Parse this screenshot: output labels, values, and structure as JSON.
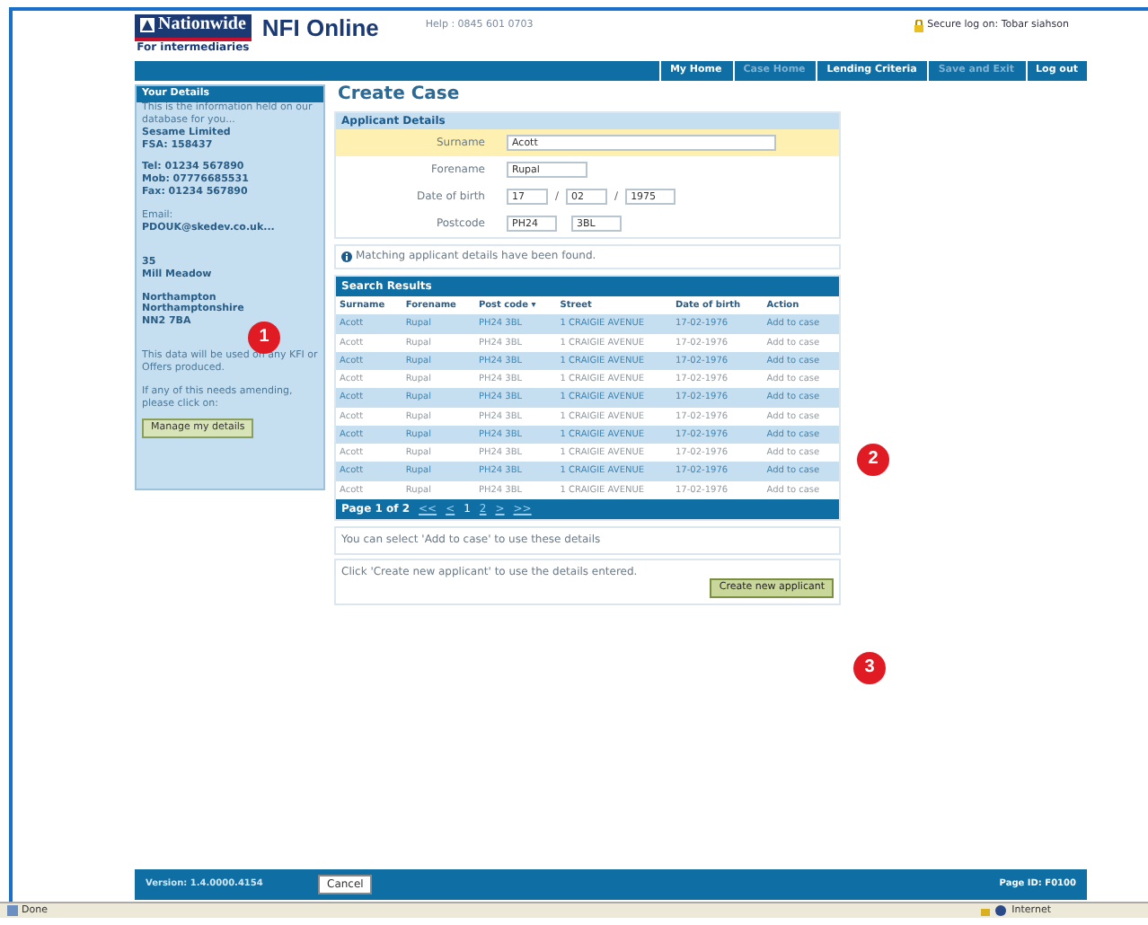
{
  "header": {
    "logo": "Nationwide",
    "logo_sub": "For intermediaries",
    "product": "NFI Online",
    "help": "Help : 0845 601 0703",
    "secure": "Secure log on: Tobar siahson"
  },
  "nav": [
    {
      "label": "My Home",
      "disabled": false
    },
    {
      "label": "Case Home",
      "disabled": true
    },
    {
      "label": "Lending Criteria",
      "disabled": false
    },
    {
      "label": "Save and Exit",
      "disabled": true
    },
    {
      "label": "Log out",
      "disabled": false
    }
  ],
  "sidebar": {
    "title": "Your Details",
    "lines": [
      {
        "kind": "text",
        "text": "This is the information held on our database for you..."
      },
      {
        "kind": "bold",
        "text": "Sesame Limited"
      },
      {
        "kind": "bold",
        "text": "FSA: 158437"
      },
      {
        "kind": "gap"
      },
      {
        "kind": "bold",
        "text": "Tel: 01234 567890"
      },
      {
        "kind": "bold",
        "text": "Mob: 07776685531"
      },
      {
        "kind": "bold",
        "text": "Fax: 01234 567890"
      },
      {
        "kind": "gap"
      },
      {
        "kind": "text",
        "text": "Email:"
      },
      {
        "kind": "bold",
        "text": "PDOUK@skedev.co.uk..."
      },
      {
        "kind": "gap"
      },
      {
        "kind": "gap"
      },
      {
        "kind": "bold",
        "text": "35"
      },
      {
        "kind": "bold",
        "text": "Mill Meadow"
      },
      {
        "kind": "gap"
      },
      {
        "kind": "bold",
        "text": "Northampton"
      },
      {
        "kind": "bold",
        "text": "Northamptonshire"
      },
      {
        "kind": "bold",
        "text": "NN2 7BA"
      },
      {
        "kind": "gap"
      },
      {
        "kind": "gap"
      },
      {
        "kind": "text",
        "text": "This data will be used on any KFI or Offers produced."
      },
      {
        "kind": "gap"
      },
      {
        "kind": "text",
        "text": "If any of this needs amending, please click on:"
      }
    ],
    "button": "Manage my details"
  },
  "page_title": "Create Case",
  "applicant": {
    "title": "Applicant Details",
    "fields": [
      {
        "label": "Surname",
        "values": [
          "Acott"
        ],
        "highlighted": true
      },
      {
        "label": "Forename",
        "values": [
          "Rupal"
        ],
        "highlighted": false
      },
      {
        "label": "Date of birth",
        "values": [
          "17",
          "02",
          "1975"
        ],
        "separator": "/",
        "highlighted": false
      },
      {
        "label": "Postcode",
        "values": [
          "PH24",
          "3BL"
        ],
        "highlighted": false
      }
    ]
  },
  "notice": "Matching applicant details have been found.",
  "results": {
    "title": "Search Results",
    "columns": [
      "Surname",
      "Forename",
      "Post code ▾",
      "Street",
      "Date of birth",
      "Action"
    ],
    "rows": [
      [
        "Acott",
        "Rupal",
        "PH24 3BL",
        "1 CRAIGIE AVENUE",
        "17-02-1976",
        "Add to case"
      ],
      [
        "Acott",
        "Rupal",
        "PH24 3BL",
        "1 CRAIGIE AVENUE",
        "17-02-1976",
        "Add to case"
      ],
      [
        "Acott",
        "Rupal",
        "PH24 3BL",
        "1 CRAIGIE AVENUE",
        "17-02-1976",
        "Add to case"
      ],
      [
        "Acott",
        "Rupal",
        "PH24 3BL",
        "1 CRAIGIE AVENUE",
        "17-02-1976",
        "Add to case"
      ],
      [
        "Acott",
        "Rupal",
        "PH24 3BL",
        "1 CRAIGIE AVENUE",
        "17-02-1976",
        "Add to case"
      ],
      [
        "Acott",
        "Rupal",
        "PH24 3BL",
        "1 CRAIGIE AVENUE",
        "17-02-1976",
        "Add to case"
      ],
      [
        "Acott",
        "Rupal",
        "PH24 3BL",
        "1 CRAIGIE AVENUE",
        "17-02-1976",
        "Add to case"
      ],
      [
        "Acott",
        "Rupal",
        "PH24 3BL",
        "1 CRAIGIE AVENUE",
        "17-02-1976",
        "Add to case"
      ],
      [
        "Acott",
        "Rupal",
        "PH24 3BL",
        "1 CRAIGIE AVENUE",
        "17-02-1976",
        "Add to case"
      ],
      [
        "Acott",
        "Rupal",
        "PH24 3BL",
        "1 CRAIGIE AVENUE",
        "17-02-1976",
        "Add to case"
      ]
    ],
    "pager_label": "Page 1 of 2",
    "pager": [
      {
        "label": "<<",
        "selected": false
      },
      {
        "label": "<",
        "selected": false
      },
      {
        "label": "1",
        "selected": true
      },
      {
        "label": "2",
        "selected": false
      },
      {
        "label": ">",
        "selected": false
      },
      {
        "label": ">>",
        "selected": false
      }
    ]
  },
  "hint_select": "You can select 'Add to case' to use these details",
  "hint_create": "Click 'Create new applicant' to use the details entered.",
  "create_button": "Create new applicant",
  "callouts": [
    "1",
    "2",
    "3"
  ],
  "footer": {
    "version": "Version: 1.4.0000.4154",
    "cancel": "Cancel",
    "page_id": "Page ID: F0100"
  },
  "status_bar": {
    "left": "Done",
    "right": "Internet"
  }
}
